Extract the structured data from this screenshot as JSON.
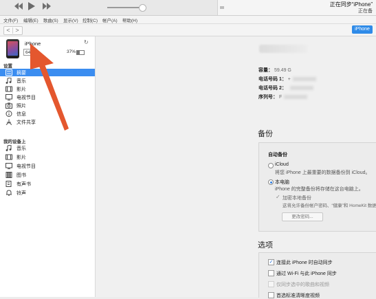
{
  "player": {
    "status_line1": "正在同步“iPhone”",
    "status_line2": "正在备",
    "icons": [
      "rewind-icon",
      "play-icon",
      "fast-forward-icon"
    ]
  },
  "menu": [
    "文件(F)",
    "编辑(E)",
    "歌曲(S)",
    "显示(V)",
    "控制(C)",
    "帐户(A)",
    "帮助(H)"
  ],
  "nav": {
    "back": "<",
    "forward": ">",
    "device_button": "iPhone"
  },
  "device": {
    "name": "iPhone",
    "capacity": "64G",
    "battery": "37%"
  },
  "sidebar": {
    "settings_header": "设置",
    "settings_items": [
      {
        "label": "摘要",
        "icon": "summary-icon",
        "selected": true
      },
      {
        "label": "音乐",
        "icon": "music-note-icon"
      },
      {
        "label": "影片",
        "icon": "film-icon"
      },
      {
        "label": "电视节目",
        "icon": "tv-icon"
      },
      {
        "label": "照片",
        "icon": "camera-icon"
      },
      {
        "label": "信息",
        "icon": "info-icon"
      },
      {
        "label": "文件共享",
        "icon": "app-share-icon"
      }
    ],
    "ondevice_header": "我的设备上",
    "ondevice_items": [
      {
        "label": "音乐",
        "icon": "music-note-icon"
      },
      {
        "label": "影片",
        "icon": "film-icon"
      },
      {
        "label": "电视节目",
        "icon": "tv-icon"
      },
      {
        "label": "图书",
        "icon": "book-icon"
      },
      {
        "label": "有声书",
        "icon": "audiobook-icon"
      },
      {
        "label": "铃声",
        "icon": "bell-icon"
      }
    ]
  },
  "summary": {
    "capacity_label": "容量：",
    "capacity_value": "59.49 G",
    "phone1_label": "电话号码 1：",
    "phone1_value": "+",
    "phone2_label": "电话号码 2：",
    "phone2_value": "",
    "serial_label": "序列号：",
    "serial_value": "F"
  },
  "backup": {
    "title": "备份",
    "auto_header": "自动备份",
    "icloud_label": "iCloud",
    "icloud_desc": "将您 iPhone 上最重要的数据备份到 iCloud。",
    "local_label": "本电脑",
    "local_desc": "iPhone 的完整备份将存储在这台电脑上。",
    "encrypt_label": "加密本地备份",
    "encrypt_desc": "这将允许备份帐户密码、“健康”和 HomeKit 数据。",
    "change_pw_button": "更改密码...",
    "selected": "local"
  },
  "options": {
    "title": "选项",
    "items": [
      {
        "label": "连接此 iPhone 时自动同步",
        "checked": true,
        "enabled": true
      },
      {
        "label": "通过 Wi-Fi 与此 iPhone 同步",
        "checked": false,
        "enabled": true
      },
      {
        "label": "仅同步选中的歌曲和视频",
        "checked": false,
        "enabled": false
      },
      {
        "label": "首选标准清晰度视频",
        "checked": false,
        "enabled": true
      }
    ]
  },
  "colors": {
    "accent": "#2f8be8",
    "selection": "#3b8df0",
    "annotation_arrow": "#e4572e"
  }
}
